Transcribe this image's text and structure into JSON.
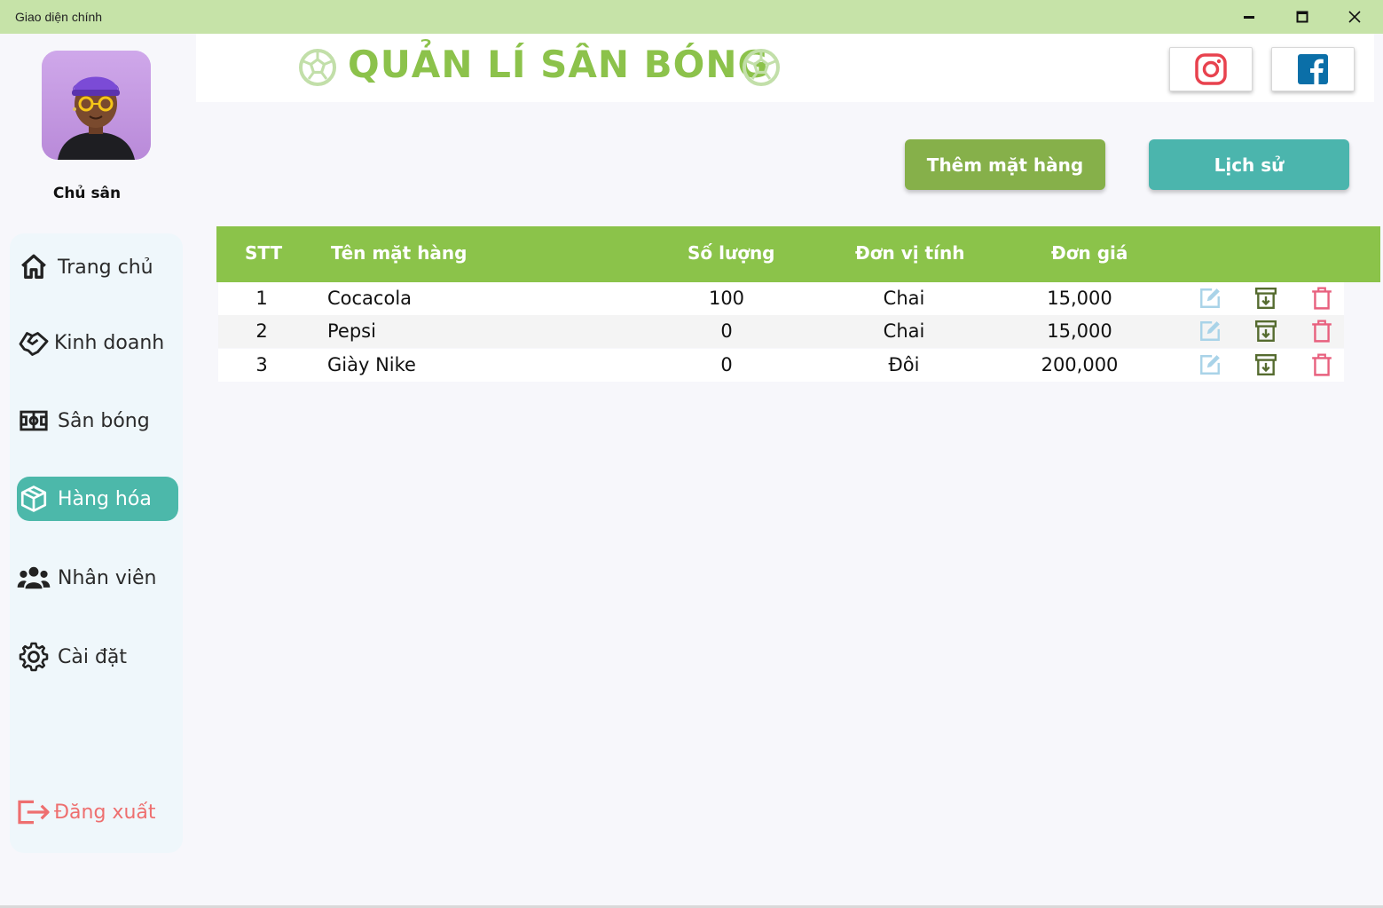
{
  "window": {
    "title": "Giao diện chính"
  },
  "user": {
    "role": "Chủ sân"
  },
  "header": {
    "app_title": "QUẢN LÍ SÂN BÓNG"
  },
  "sidebar": {
    "items": [
      {
        "label": "Trang chủ",
        "icon": "home-icon"
      },
      {
        "label": "Kinh doanh",
        "icon": "handshake-icon"
      },
      {
        "label": "Sân bóng",
        "icon": "field-icon"
      },
      {
        "label": "Hàng hóa",
        "icon": "box-icon",
        "active": true
      },
      {
        "label": "Nhân viên",
        "icon": "users-icon"
      },
      {
        "label": "Cài đặt",
        "icon": "gear-icon"
      }
    ],
    "logout_label": "Đăng xuất"
  },
  "actions": {
    "add_label": "Thêm mặt hàng",
    "history_label": "Lịch sử"
  },
  "table": {
    "columns": [
      "STT",
      "Tên mặt hàng",
      "Số lượng",
      "Đơn vị tính",
      "Đơn giá"
    ],
    "rows": [
      {
        "stt": "1",
        "name": "Cocacola",
        "qty": "100",
        "unit": "Chai",
        "price": "15,000"
      },
      {
        "stt": "2",
        "name": "Pepsi",
        "qty": "0",
        "unit": "Chai",
        "price": "15,000"
      },
      {
        "stt": "3",
        "name": "Giày Nike",
        "qty": "0",
        "unit": "Đôi",
        "price": "200,000"
      }
    ]
  },
  "colors": {
    "accent_green": "#8bc34a",
    "teal": "#4cb8aa",
    "logout_red": "#ee6f6f",
    "titlebar": "#c6e3a8"
  }
}
